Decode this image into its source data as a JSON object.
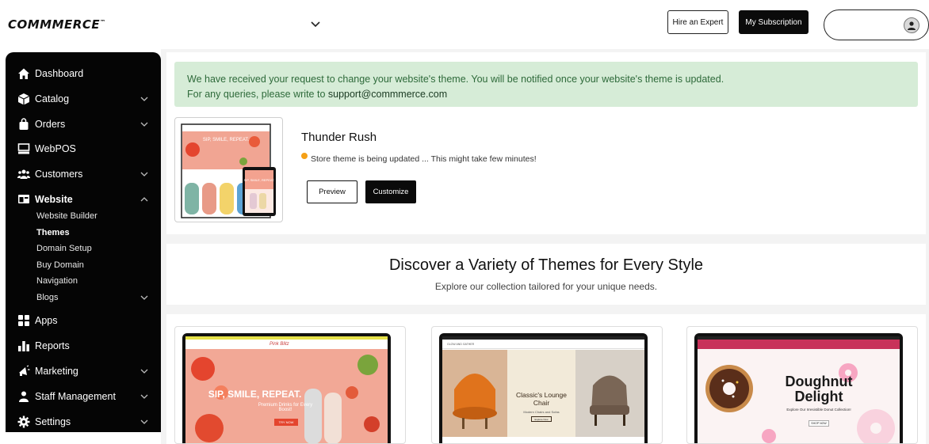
{
  "brand": {
    "logo": "COMMMERCE",
    "tm": "™"
  },
  "header": {
    "hire_label": "Hire an Expert",
    "subscription_label": "My Subscription"
  },
  "sidebar": {
    "items": [
      {
        "label": "Dashboard",
        "icon": "home-icon"
      },
      {
        "label": "Catalog",
        "icon": "box-icon"
      },
      {
        "label": "Orders",
        "icon": "bag-icon"
      },
      {
        "label": "WebPOS",
        "icon": "pos-icon"
      },
      {
        "label": "Customers",
        "icon": "users-icon"
      },
      {
        "label": "Website",
        "icon": "website-icon"
      },
      {
        "label": "Apps",
        "icon": "apps-icon"
      },
      {
        "label": "Reports",
        "icon": "reports-icon"
      },
      {
        "label": "Marketing",
        "icon": "megaphone-icon"
      },
      {
        "label": "Staff Management",
        "icon": "staff-icon"
      },
      {
        "label": "Settings",
        "icon": "gear-icon"
      }
    ],
    "website_sub": [
      "Website Builder",
      "Themes",
      "Domain Setup",
      "Buy Domain",
      "Navigation",
      "Blogs"
    ]
  },
  "alert": {
    "line1": "We have received your request to change your website's theme. You will be notified once your website's theme is updated.",
    "line2_prefix": "For any queries, please write to ",
    "email": "support@commmerce.com"
  },
  "current_theme": {
    "name": "Thunder Rush",
    "status": "Store theme is being updated ... This might take few minutes!",
    "preview_label": "Preview",
    "customize_label": "Customize",
    "thumb_tagline": "SIP, SMILE, REPEAT."
  },
  "discover": {
    "title": "Discover a Variety of Themes for Every Style",
    "subtitle": "Explore our collection tailored for your unique needs."
  },
  "theme_cards": [
    {
      "headline": "SIP, SMILE, REPEAT.",
      "sub": "Premium Drinks for Every Boost!",
      "cta": "TRY NOW",
      "brand": "Pink Blitz"
    },
    {
      "headline": "Classic's Lounge Chair",
      "sub": "Modern Chairs and Sofas",
      "cta": "Explore Now",
      "brand": "GLOW AND GATHER"
    },
    {
      "headline": "Doughnut Delight",
      "sub": "Explore Our Irresistible Donut Collection!",
      "cta": "SHOP NOW"
    }
  ],
  "colors": {
    "alert_bg": "#d6ecd7",
    "alert_text": "#2e6a3a",
    "status_dot": "#f5a016",
    "sidebar_bg": "#050505"
  }
}
